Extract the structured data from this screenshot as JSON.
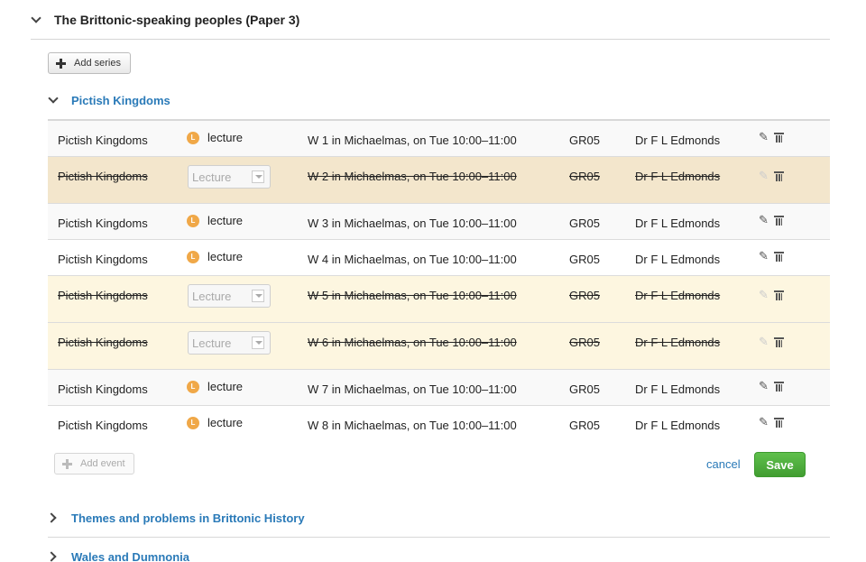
{
  "paper": {
    "title": "The Brittonic-speaking peoples (Paper 3)"
  },
  "toolbar": {
    "add_series_label": "Add series"
  },
  "series": {
    "title": "Pictish Kingdoms",
    "events": [
      {
        "title": "Pictish Kingdoms",
        "type_badge": "L",
        "type": "lecture",
        "when": "W 1 in Michaelmas, on Tue 10:00–11:00",
        "location": "GR05",
        "lecturer": "Dr F L Edmonds"
      },
      {
        "title": "Pictish Kingdoms",
        "type": "Lecture",
        "when": "W 2 in Michaelmas, on Tue 10:00–11:00",
        "location": "GR05",
        "lecturer": "Dr F L Edmonds"
      },
      {
        "title": "Pictish Kingdoms",
        "type_badge": "L",
        "type": "lecture",
        "when": "W 3 in Michaelmas, on Tue 10:00–11:00",
        "location": "GR05",
        "lecturer": "Dr F L Edmonds"
      },
      {
        "title": "Pictish Kingdoms",
        "type_badge": "L",
        "type": "lecture",
        "when": "W 4 in Michaelmas, on Tue 10:00–11:00",
        "location": "GR05",
        "lecturer": "Dr F L Edmonds"
      },
      {
        "title": "Pictish Kingdoms",
        "type": "Lecture",
        "when": "W 5 in Michaelmas, on Tue 10:00–11:00",
        "location": "GR05",
        "lecturer": "Dr F L Edmonds"
      },
      {
        "title": "Pictish Kingdoms",
        "type": "Lecture",
        "when": "W 6 in Michaelmas, on Tue 10:00–11:00",
        "location": "GR05",
        "lecturer": "Dr F L Edmonds"
      },
      {
        "title": "Pictish Kingdoms",
        "type_badge": "L",
        "type": "lecture",
        "when": "W 7 in Michaelmas, on Tue 10:00–11:00",
        "location": "GR05",
        "lecturer": "Dr F L Edmonds"
      },
      {
        "title": "Pictish Kingdoms",
        "type_badge": "L",
        "type": "lecture",
        "when": "W 8 in Michaelmas, on Tue 10:00–11:00",
        "location": "GR05",
        "lecturer": "Dr F L Edmonds"
      }
    ]
  },
  "actions": {
    "add_event_label": "Add event",
    "cancel_label": "cancel",
    "save_label": "Save"
  },
  "other_series": [
    {
      "title": "Themes and problems in Brittonic History"
    },
    {
      "title": "Wales and Dumnonia"
    }
  ],
  "colors": {
    "link": "#2a7ab8",
    "save": "#4cae3b",
    "cancelled_row": "#fdf6e0",
    "cancelled_selected_row": "#f3e6cc",
    "badge": "#f0a848"
  }
}
